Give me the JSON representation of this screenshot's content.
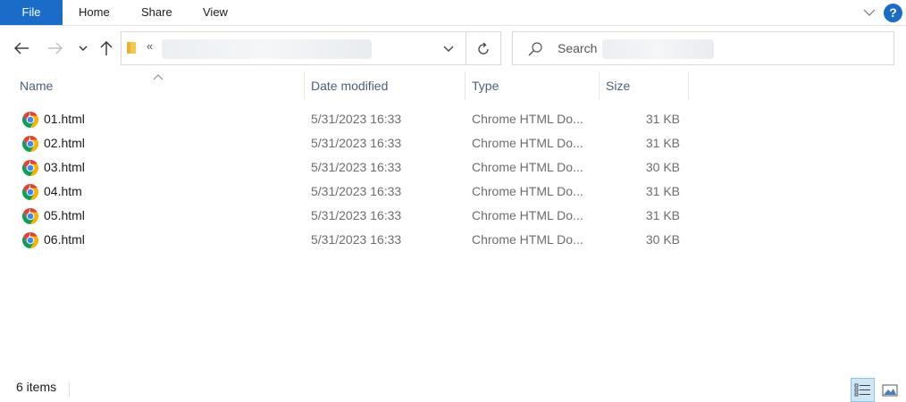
{
  "ribbon": {
    "tabs": [
      {
        "label": "File"
      },
      {
        "label": "Home"
      },
      {
        "label": "Share"
      },
      {
        "label": "View"
      }
    ],
    "help_label": "?"
  },
  "address": {
    "separator": "«",
    "path_visible": ""
  },
  "search": {
    "placeholder": "Search"
  },
  "columns": [
    {
      "label": "Name"
    },
    {
      "label": "Date modified"
    },
    {
      "label": "Type"
    },
    {
      "label": "Size"
    }
  ],
  "files": [
    {
      "name": "01.html",
      "date": "5/31/2023 16:33",
      "type": "Chrome HTML Do...",
      "size": "31 KB"
    },
    {
      "name": "02.html",
      "date": "5/31/2023 16:33",
      "type": "Chrome HTML Do...",
      "size": "31 KB"
    },
    {
      "name": "03.html",
      "date": "5/31/2023 16:33",
      "type": "Chrome HTML Do...",
      "size": "30 KB"
    },
    {
      "name": "04.htm",
      "date": "5/31/2023 16:33",
      "type": "Chrome HTML Do...",
      "size": "31 KB"
    },
    {
      "name": "05.html",
      "date": "5/31/2023 16:33",
      "type": "Chrome HTML Do...",
      "size": "31 KB"
    },
    {
      "name": "06.html",
      "date": "5/31/2023 16:33",
      "type": "Chrome HTML Do...",
      "size": "30 KB"
    }
  ],
  "status": {
    "item_count": "6 items"
  },
  "colors": {
    "accent": "#1a6cc8",
    "header_text": "#4c607a",
    "chrome_red": "#db4437",
    "chrome_yellow": "#f4b400",
    "chrome_green": "#0f9d58",
    "chrome_blue": "#4285f4"
  },
  "icons": {
    "file": "chrome-html-icon",
    "nav_back": "arrow-left-icon",
    "nav_forward": "arrow-right-icon",
    "nav_up": "arrow-up-icon",
    "refresh": "refresh-icon",
    "search": "magnifier-icon"
  }
}
